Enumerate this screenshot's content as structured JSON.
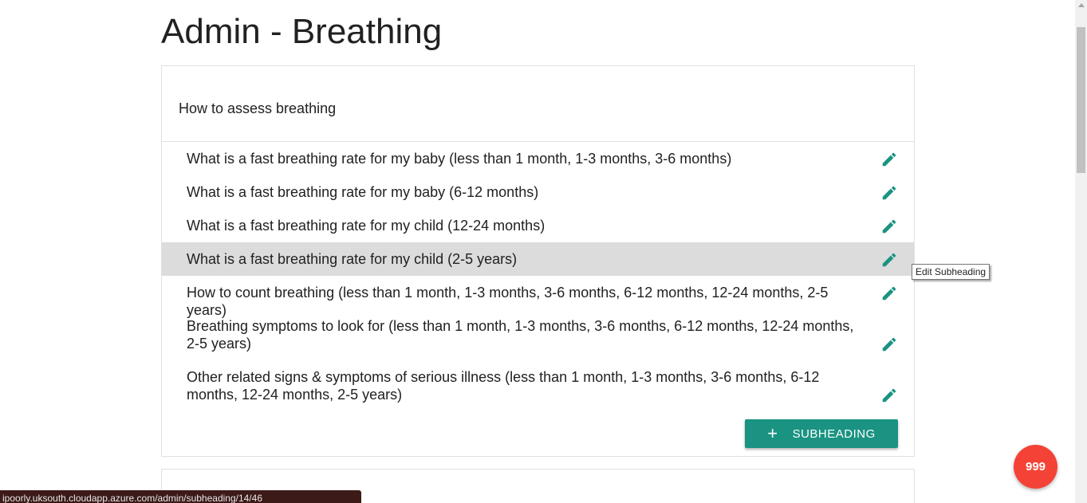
{
  "page": {
    "title": "Admin - Breathing"
  },
  "section": {
    "heading": "How to assess breathing",
    "subheadings": [
      {
        "label": "What is a fast breathing rate for my baby (less than 1 month, 1-3 months, 3-6 months)"
      },
      {
        "label": "What is a fast breathing rate for my baby (6-12 months)"
      },
      {
        "label": "What is a fast breathing rate for my child (12-24 months)"
      },
      {
        "label": "What is a fast breathing rate for my child (2-5 years)"
      },
      {
        "label": "How to count breathing (less than 1 month, 1-3 months, 3-6 months, 6-12 months, 12-24 months, 2-5 years)"
      },
      {
        "label": "Breathing symptoms to look for (less than 1 month, 1-3 months, 3-6 months, 6-12 months, 12-24 months, 2-5 years)"
      },
      {
        "label": "Other related signs & symptoms of serious illness (less than 1 month, 1-3 months, 3-6 months, 6-12 months, 12-24 months, 2-5 years)"
      }
    ],
    "add_button_icon": "+",
    "add_button_label": "SUBHEADING"
  },
  "tooltip": {
    "text": "Edit Subheading"
  },
  "fab": {
    "label": "999"
  },
  "status_bar": {
    "url": "ipoorly.uksouth.cloudapp.azure.com/admin/subheading/14/46"
  },
  "colors": {
    "accent": "#1a9382",
    "fab": "#f44336",
    "highlight_row": "#dcdcdc"
  }
}
